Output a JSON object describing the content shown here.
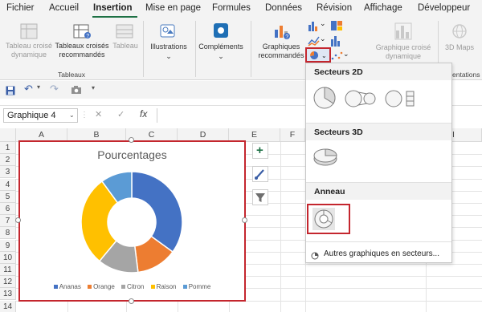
{
  "tabs": [
    "Fichier",
    "Accueil",
    "Insertion",
    "Mise en page",
    "Formules",
    "Données",
    "Révision",
    "Affichage",
    "Développeur"
  ],
  "ribbon": {
    "pivot_label": "Tableau croisé dynamique",
    "recommended_pivot_label": "Tableaux croisés recommandés",
    "table_label": "Tableau",
    "group_tables": "Tableaux",
    "illustrations_label": "Illustrations",
    "addins_label": "Compléments",
    "recommended_charts_label": "Graphiques recommandés",
    "pivot_chart_label": "Graphique croisé dynamique",
    "maps_label": "3D Maps",
    "group_presentations": "entations"
  },
  "formula_bar": {
    "name_box": "Graphique 4",
    "fx": "fx",
    "cancel": "✕",
    "confirm": "✓"
  },
  "columns": [
    "A",
    "B",
    "C",
    "D",
    "E",
    "F",
    "I"
  ],
  "rows": [
    "1",
    "2",
    "3",
    "4",
    "5",
    "6",
    "7",
    "8",
    "9",
    "10",
    "11",
    "12",
    "13",
    "14"
  ],
  "chart_data": {
    "type": "pie",
    "variant": "doughnut",
    "title": "Pourcentages",
    "categories": [
      "Ananas",
      "Orange",
      "Citron",
      "Raison",
      "Pomme"
    ],
    "values": [
      35,
      13,
      13,
      29,
      10
    ],
    "colors": [
      "#4472c4",
      "#ed7d31",
      "#a5a5a5",
      "#ffc000",
      "#5b9bd5"
    ],
    "legend_position": "bottom"
  },
  "dropdown": {
    "section_2d": "Secteurs 2D",
    "section_3d": "Secteurs 3D",
    "section_ring": "Anneau",
    "more": "Autres graphiques en secteurs..."
  },
  "accent": "#1e7145",
  "highlight": "#c4262e"
}
